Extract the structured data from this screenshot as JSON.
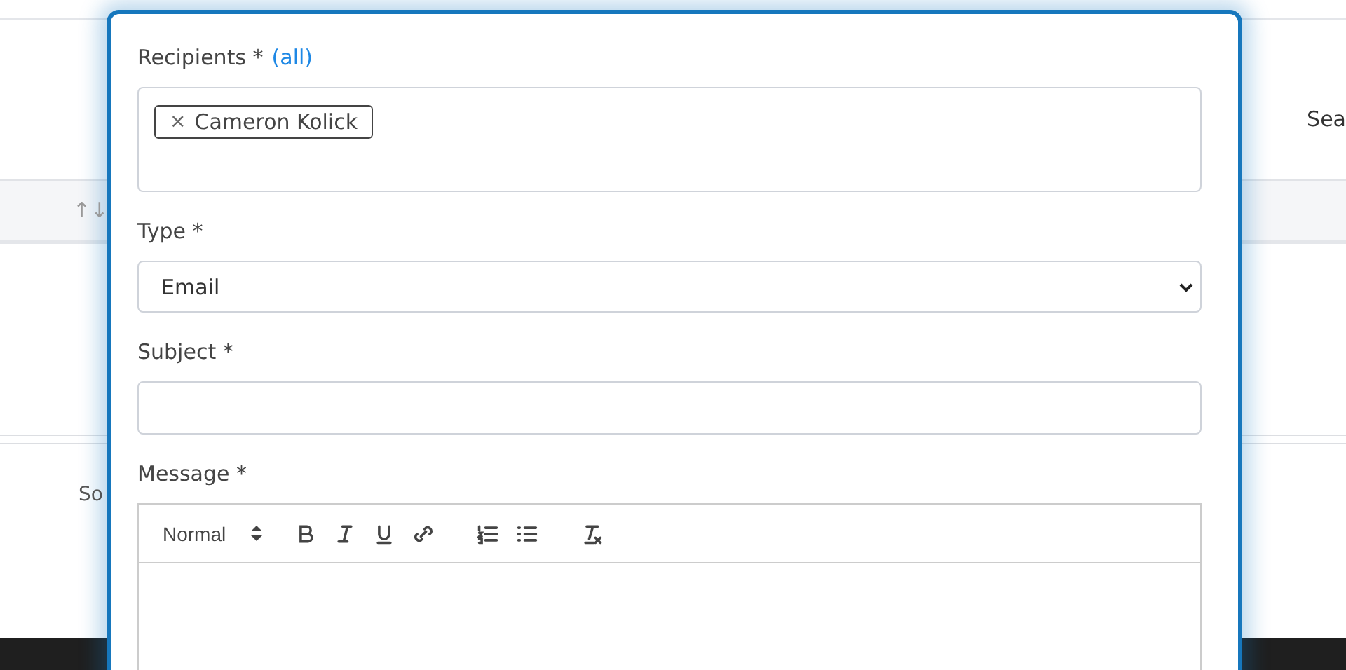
{
  "background": {
    "search_label": "Sea",
    "sort_arrows": "↑↓",
    "partial_label": "So"
  },
  "modal": {
    "recipients": {
      "label": "Recipients *",
      "all_link": "(all)",
      "chips": [
        {
          "remove": "×",
          "name": "Cameron Kolick"
        }
      ]
    },
    "type": {
      "label": "Type *",
      "value": "Email"
    },
    "subject": {
      "label": "Subject *"
    },
    "message": {
      "label": "Message *",
      "format": "Normal"
    }
  }
}
